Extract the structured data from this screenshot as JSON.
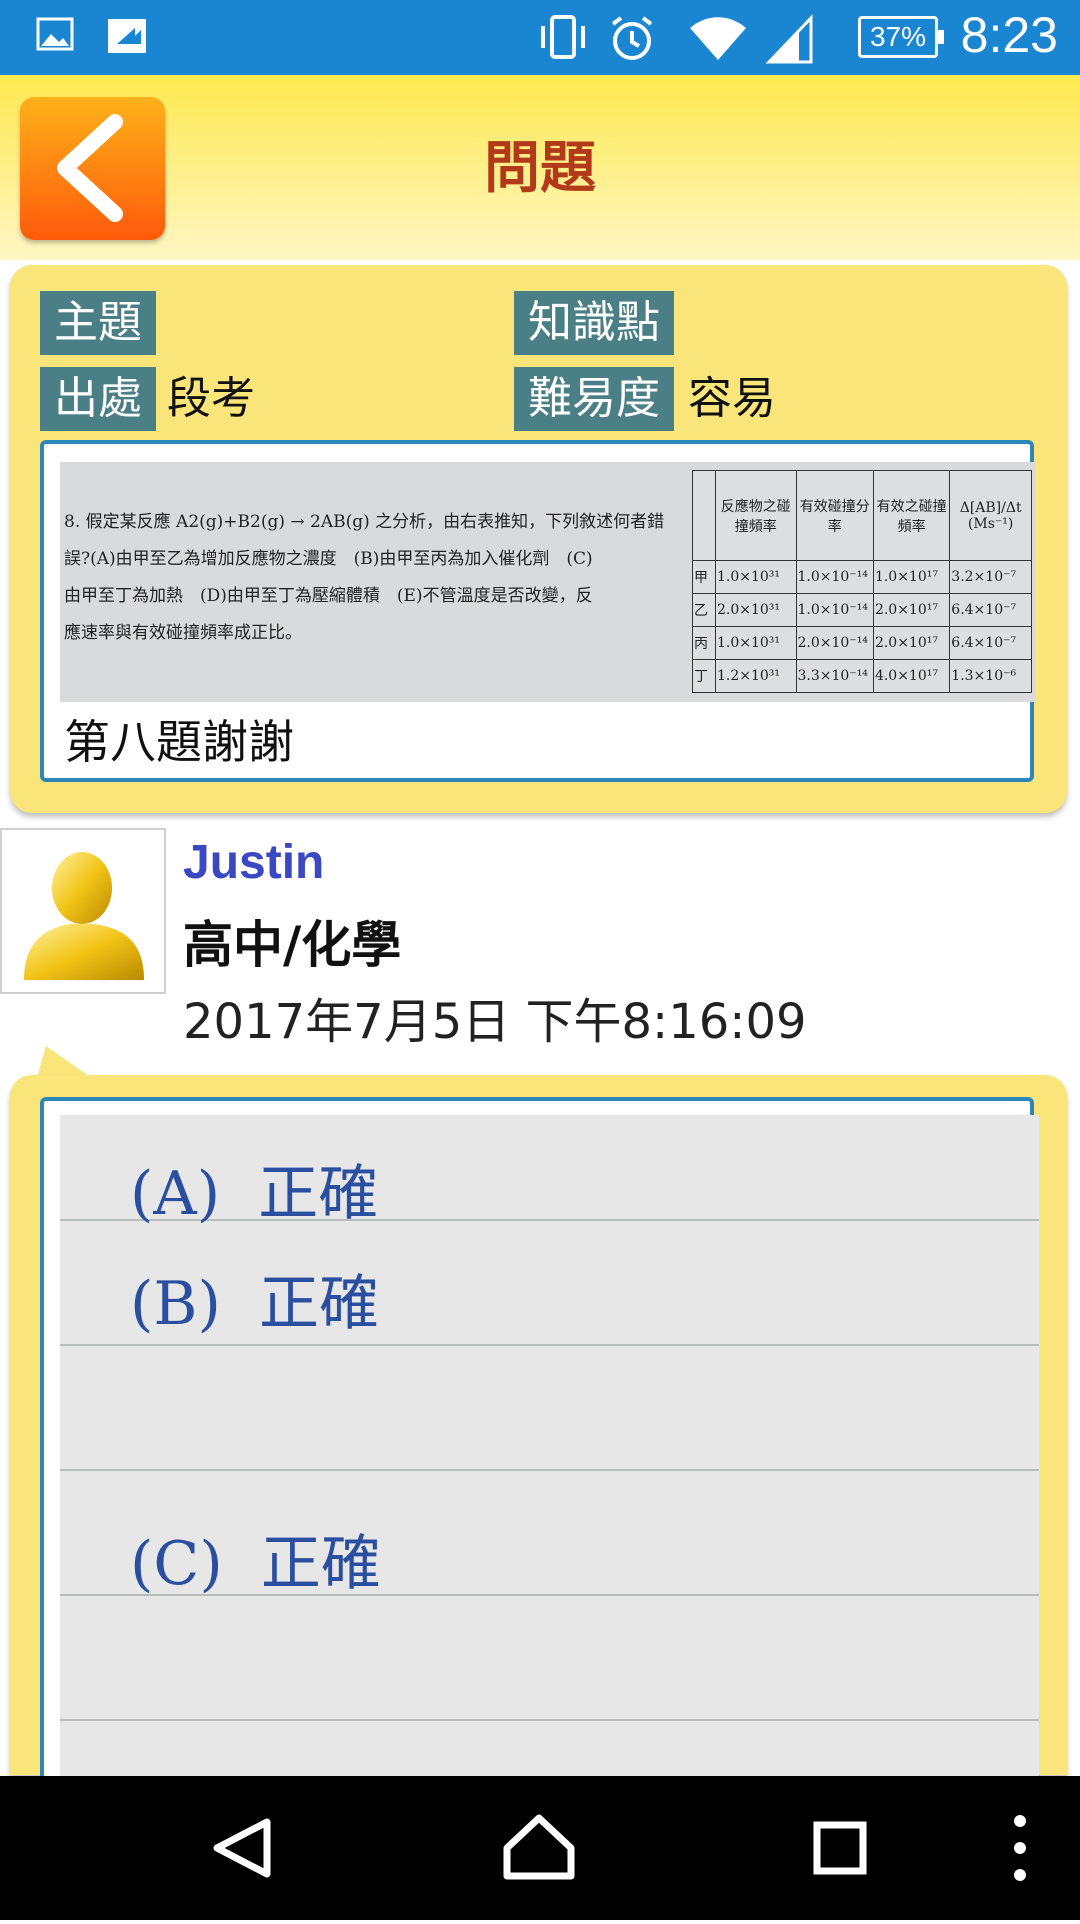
{
  "status_bar": {
    "time": "8:23",
    "battery": "37%",
    "icons": [
      "image-icon",
      "screen-share-icon",
      "vibrate-icon",
      "alarm-icon",
      "wifi-icon",
      "signal-icon"
    ]
  },
  "header": {
    "title": "問題",
    "back_icon": "chevron-left-icon"
  },
  "question": {
    "topic_label": "主題",
    "topic_value": "",
    "knowledge_label": "知識點",
    "knowledge_value": "",
    "source_label": "出處",
    "source_value": "段考",
    "difficulty_label": "難易度",
    "difficulty_value": "容易",
    "image": {
      "question_number": "8.",
      "line1": "假定某反應 A2(g)+B2(g) → 2AB(g) 之分析，由右表推知，下列敘述何者錯",
      "line2": "誤?(A)由甲至乙為增加反應物之濃度　(B)由甲至丙為加入催化劑　(C)",
      "line3": "由甲至丁為加熱　(D)由甲至丁為壓縮體積　(E)不管溫度是否改變，反",
      "line4": "應速率與有效碰撞頻率成正比。",
      "table_headers": [
        "反應物之碰撞頻率",
        "有效碰撞分率",
        "有效之碰撞頻率",
        "Δ[AB]/Δt (Ms⁻¹)"
      ],
      "table_rows": [
        {
          "label": "甲",
          "cells": [
            "1.0×10³¹",
            "1.0×10⁻¹⁴",
            "1.0×10¹⁷",
            "3.2×10⁻⁷"
          ]
        },
        {
          "label": "乙",
          "cells": [
            "2.0×10³¹",
            "1.0×10⁻¹⁴",
            "2.0×10¹⁷",
            "6.4×10⁻⁷"
          ]
        },
        {
          "label": "丙",
          "cells": [
            "1.0×10³¹",
            "2.0×10⁻¹⁴",
            "2.0×10¹⁷",
            "6.4×10⁻⁷"
          ]
        },
        {
          "label": "丁",
          "cells": [
            "1.2×10³¹",
            "3.3×10⁻¹⁴",
            "4.0×10¹⁷",
            "1.3×10⁻⁶"
          ]
        }
      ]
    },
    "text": "第八題謝謝"
  },
  "answer": {
    "user_name": "Justin",
    "subject": "高中/化學",
    "timestamp": "2017年7月5日 下午8:16:09",
    "image_lines": [
      "(A)  正確",
      "(B)  正確",
      "(C)  正確"
    ]
  },
  "nav_bar": {
    "icons": [
      "back-triangle-icon",
      "home-icon",
      "recents-icon",
      "more-vert-icon"
    ]
  }
}
